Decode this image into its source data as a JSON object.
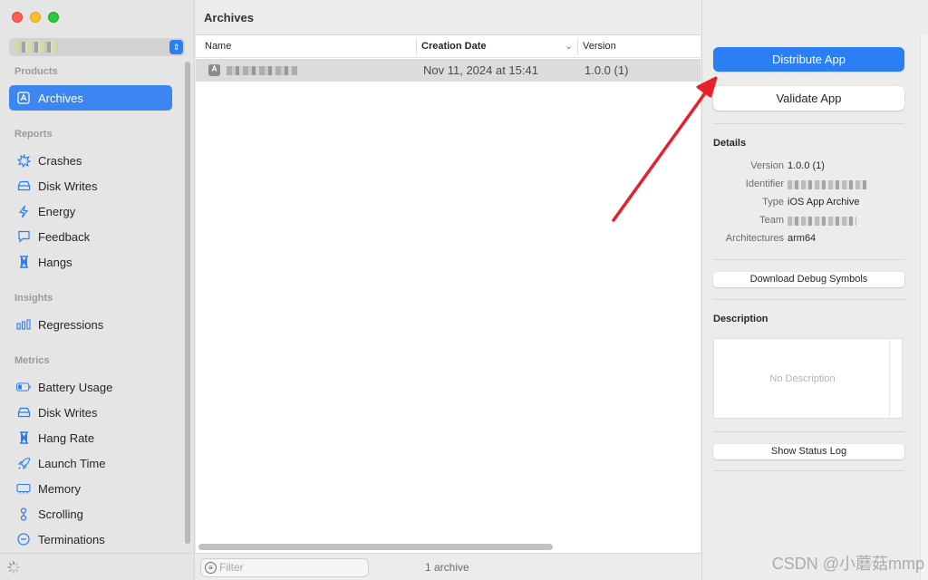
{
  "sidebar": {
    "sections": {
      "products": "Products",
      "reports": "Reports",
      "insights": "Insights",
      "metrics": "Metrics"
    },
    "products": [
      {
        "label": "Archives",
        "icon": "archive-box-icon",
        "active": true
      }
    ],
    "reports": [
      {
        "label": "Crashes",
        "icon": "crash-burst-icon"
      },
      {
        "label": "Disk Writes",
        "icon": "disk-icon"
      },
      {
        "label": "Energy",
        "icon": "bolt-icon"
      },
      {
        "label": "Feedback",
        "icon": "speech-bubble-icon"
      },
      {
        "label": "Hangs",
        "icon": "hourglass-icon"
      }
    ],
    "insights": [
      {
        "label": "Regressions",
        "icon": "bar-chart-icon"
      }
    ],
    "metrics": [
      {
        "label": "Battery Usage",
        "icon": "battery-icon"
      },
      {
        "label": "Disk Writes",
        "icon": "disk-icon"
      },
      {
        "label": "Hang Rate",
        "icon": "hourglass-icon"
      },
      {
        "label": "Launch Time",
        "icon": "rocket-icon"
      },
      {
        "label": "Memory",
        "icon": "memory-chip-icon"
      },
      {
        "label": "Scrolling",
        "icon": "scroll-icon"
      },
      {
        "label": "Terminations",
        "icon": "termination-icon"
      }
    ]
  },
  "main": {
    "title": "Archives",
    "columns": {
      "name": "Name",
      "creation_date": "Creation Date",
      "version": "Version"
    },
    "rows": [
      {
        "date": "Nov 11, 2024 at 15:41",
        "version": "1.0.0 (1)"
      }
    ],
    "filter_placeholder": "Filter",
    "archive_count": "1 archive"
  },
  "inspector": {
    "distribute_label": "Distribute App",
    "validate_label": "Validate App",
    "details_title": "Details",
    "details": {
      "version_key": "Version",
      "version_value": "1.0.0 (1)",
      "identifier_key": "Identifier",
      "type_key": "Type",
      "type_value": "iOS App Archive",
      "team_key": "Team",
      "architectures_key": "Architectures",
      "architectures_value": "arm64"
    },
    "download_debug_label": "Download Debug Symbols",
    "description_title": "Description",
    "description_placeholder": "No Description",
    "show_status_log_label": "Show Status Log"
  },
  "watermark": "CSDN @小蘑菇mmp",
  "colors": {
    "accent": "#2b7ff2",
    "annotation_arrow": "#e8202a"
  }
}
